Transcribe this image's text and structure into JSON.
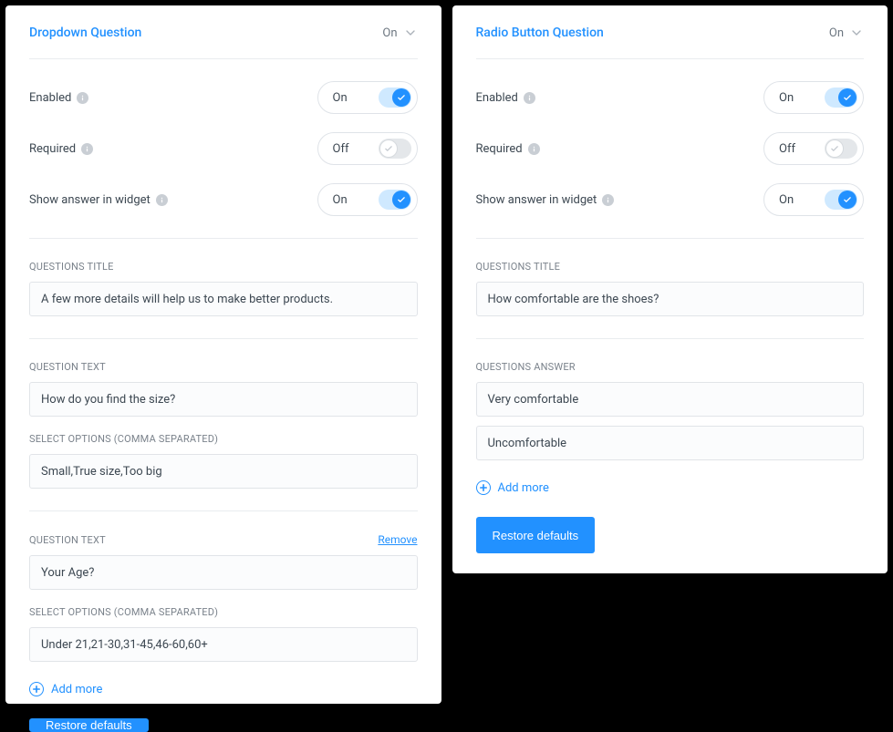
{
  "left": {
    "title": "Dropdown Question",
    "state": "On",
    "toggles": {
      "enabled": {
        "label": "Enabled",
        "value": "On",
        "on": true
      },
      "required": {
        "label": "Required",
        "value": "Off",
        "on": false
      },
      "widget": {
        "label": "Show answer in widget",
        "value": "On",
        "on": true
      }
    },
    "questions_title_label": "QUESTIONS TITLE",
    "questions_title_value": "A few more details will help us to make better products.",
    "question_text_label": "QUESTION TEXT",
    "select_options_label": "SELECT OPTIONS (comma separated)",
    "remove_label": "Remove",
    "groups": [
      {
        "text": "How do you find the size?",
        "options": "Small,True size,Too big"
      },
      {
        "text": "Your Age?",
        "options": "Under 21,21-30,31-45,46-60,60+"
      }
    ],
    "add_more": "Add more",
    "restore": "Restore defaults"
  },
  "right": {
    "title": "Radio Button Question",
    "state": "On",
    "toggles": {
      "enabled": {
        "label": "Enabled",
        "value": "On",
        "on": true
      },
      "required": {
        "label": "Required",
        "value": "Off",
        "on": false
      },
      "widget": {
        "label": "Show answer in widget",
        "value": "On",
        "on": true
      }
    },
    "questions_title_label": "QUESTIONS TITLE",
    "questions_title_value": "How comfortable are the shoes?",
    "questions_answer_label": "QUESTIONS ANSWER",
    "answers": [
      "Very comfortable",
      "Uncomfortable"
    ],
    "add_more": "Add more",
    "restore": "Restore defaults"
  }
}
